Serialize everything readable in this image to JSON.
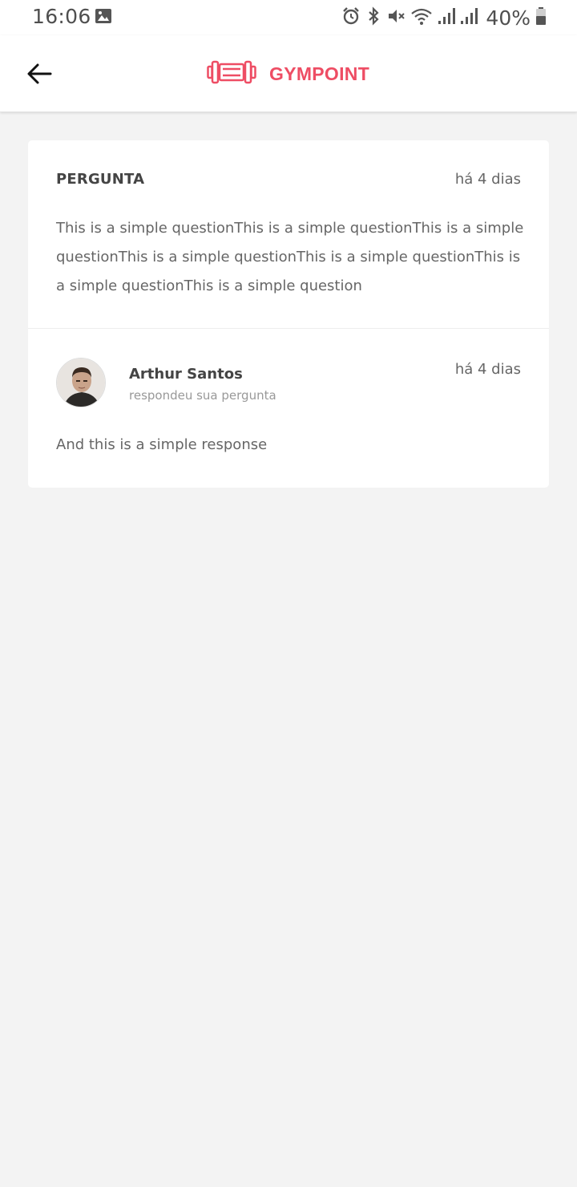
{
  "status_bar": {
    "time": "16:06",
    "battery": "40%",
    "icons": [
      "gallery-icon",
      "alarm-icon",
      "bluetooth-icon",
      "mute-icon",
      "wifi-icon",
      "signal-icon",
      "signal-icon",
      "battery-icon"
    ]
  },
  "header": {
    "brand": "GYMPOINT",
    "brand_color": "#ee4d64",
    "back_icon": "arrow-left-icon",
    "logo_icon": "dumbbell-icon"
  },
  "question": {
    "label": "PERGUNTA",
    "time": "há 4 dias",
    "text": "This is a simple questionThis is a simple questionThis is a simple questionThis is a simple questionThis is a simple questionThis is a simple questionThis is a simple question"
  },
  "answer": {
    "author": "Arthur Santos",
    "subtitle": "respondeu sua pergunta",
    "time": "há 4 dias",
    "text": "And this is a simple response"
  }
}
